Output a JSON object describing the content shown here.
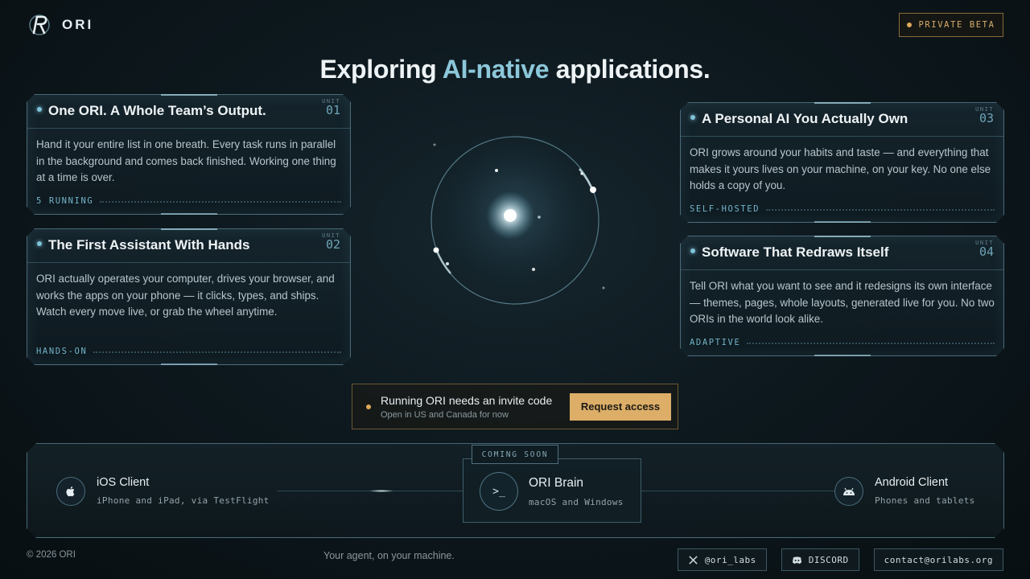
{
  "brand": {
    "name": "ORI",
    "logo_icon": "ori-logo-icon"
  },
  "badge": {
    "label": "PRIVATE BETA",
    "color": "#e0a95a"
  },
  "headline": {
    "before": "Exploring ",
    "accent": "AI-native",
    "after": " applications."
  },
  "cards": [
    {
      "title": "One ORI. A Whole Team’s Output.",
      "unit_label": "UNIT",
      "unit_num": "01",
      "body": "Hand it your entire list in one breath. Every task runs in parallel in the background and comes back finished. Working one thing at a time is over.",
      "tag": "5 RUNNING"
    },
    {
      "title": "The First Assistant With Hands",
      "unit_label": "UNIT",
      "unit_num": "02",
      "body": "ORI actually operates your computer, drives your browser, and works the apps on your phone — it clicks, types, and ships. Watch every move live, or grab the wheel anytime.",
      "tag": "HANDS-ON"
    },
    {
      "title": "A Personal AI You Actually Own",
      "unit_label": "UNIT",
      "unit_num": "03",
      "body": "ORI grows around your habits and taste — and everything that makes it yours lives on your machine, on your key. No one else holds a copy of you.",
      "tag": "SELF-HOSTED"
    },
    {
      "title": "Software That Redraws Itself",
      "unit_label": "UNIT",
      "unit_num": "04",
      "body": "Tell ORI what you want to see and it redesigns its own interface — themes, pages, whole layouts, generated live for you. No two ORIs in the world look alike.",
      "tag": "ADAPTIVE"
    }
  ],
  "invite": {
    "title": "Running ORI needs an invite code",
    "subtitle": "Open in US and Canada for now",
    "button": "Request access"
  },
  "platforms": {
    "coming_soon": "COMING SOON",
    "ios": {
      "name": "iOS Client",
      "sub": "iPhone and iPad, via TestFlight",
      "icon": "apple-icon"
    },
    "brain": {
      "name": "ORI Brain",
      "sub": "macOS and Windows",
      "icon": "terminal-icon",
      "glyph": ">_"
    },
    "android": {
      "name": "Android Client",
      "sub": "Phones and tablets",
      "icon": "android-icon"
    }
  },
  "footer": {
    "copyright": "© 2026 ORI",
    "tagline": "Your agent, on your machine.",
    "x_handle": "@ori_labs",
    "discord": "DISCORD",
    "email": "contact@orilabs.org"
  }
}
